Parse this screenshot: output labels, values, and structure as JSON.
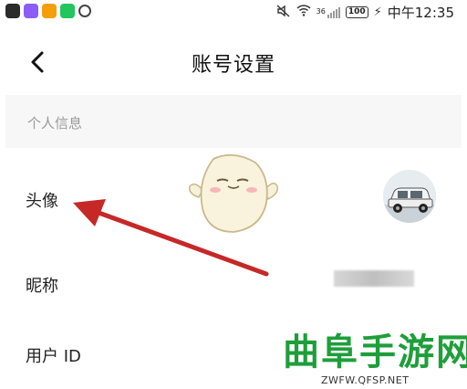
{
  "status_bar": {
    "network": "36",
    "battery": "100",
    "time": "中午12:35"
  },
  "header": {
    "back_icon": "chevron-left-icon",
    "title": "账号设置"
  },
  "section": {
    "label": "个人信息"
  },
  "rows": {
    "avatar_label": "头像",
    "nickname_label": "昵称",
    "userid_label": "用户 ID"
  },
  "watermark": {
    "title": "曲阜手游网",
    "url": "ZWFW.QFSP.NET"
  },
  "colors": {
    "arrow": "#c62828",
    "watermark_green": "#1e9e3a",
    "section_bg": "#f7f7f7"
  }
}
